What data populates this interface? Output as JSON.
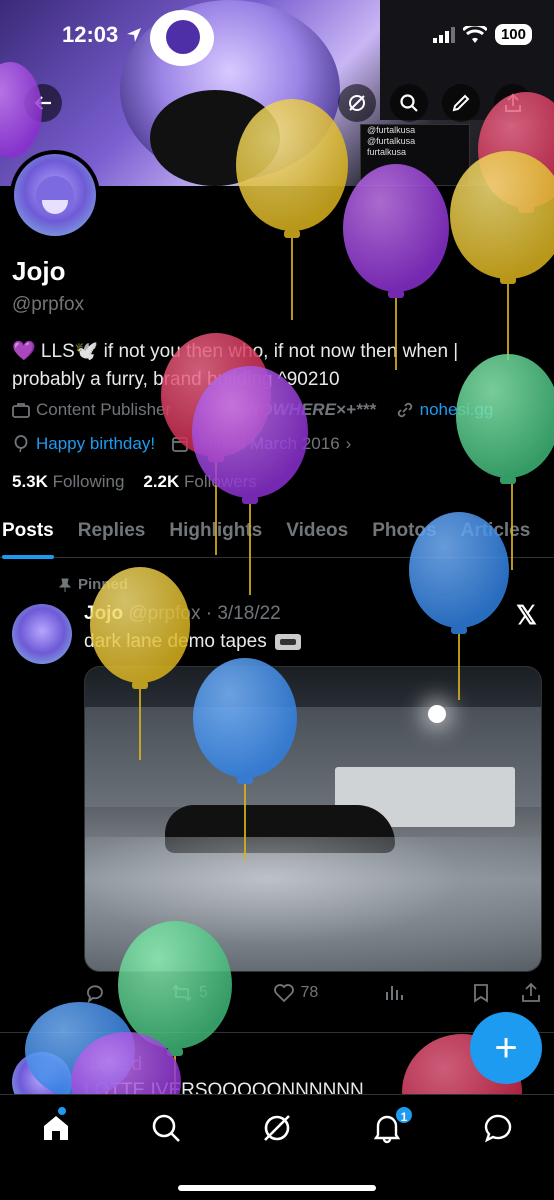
{
  "status_bar": {
    "time": "12:03",
    "battery": "100"
  },
  "banner": {
    "box_lines": [
      "@furtalkusa",
      "@furtalkusa",
      "furtalkusa"
    ]
  },
  "profile": {
    "name": "Jojo",
    "handle": "@prpfox",
    "bio_line1": "💜 LLS🕊️ if not you then who, if not now then when |",
    "bio_line2": "probably a furry, brand building ^90210",
    "job": "Content Publisher",
    "job_extra": "NOWHERE×+***",
    "website": "nohesi.gg",
    "birthday": "Happy birthday!",
    "joined": "Joined March 2016",
    "following_count": "5.3K",
    "following_label": "Following",
    "followers_count": "2.2K",
    "followers_label": "Followers"
  },
  "tabs": [
    "Posts",
    "Replies",
    "Highlights",
    "Videos",
    "Photos",
    "Articles"
  ],
  "pinned_post": {
    "pinned_label": "Pinned",
    "name": "Jojo",
    "handle": "@prpfox",
    "date": "· 3/18/22",
    "text": "dark lane demo tapes",
    "reposts": "5",
    "likes": "78"
  },
  "second_post": {
    "handle": "ox · 1d",
    "text": "LOTTE IVERSOOOOONNNNNN"
  },
  "fab": {
    "label": "+"
  },
  "nav": {
    "notifications_badge": "1"
  },
  "colors": {
    "accent": "#1d9bf0",
    "background": "#000000",
    "muted": "#71767b"
  }
}
